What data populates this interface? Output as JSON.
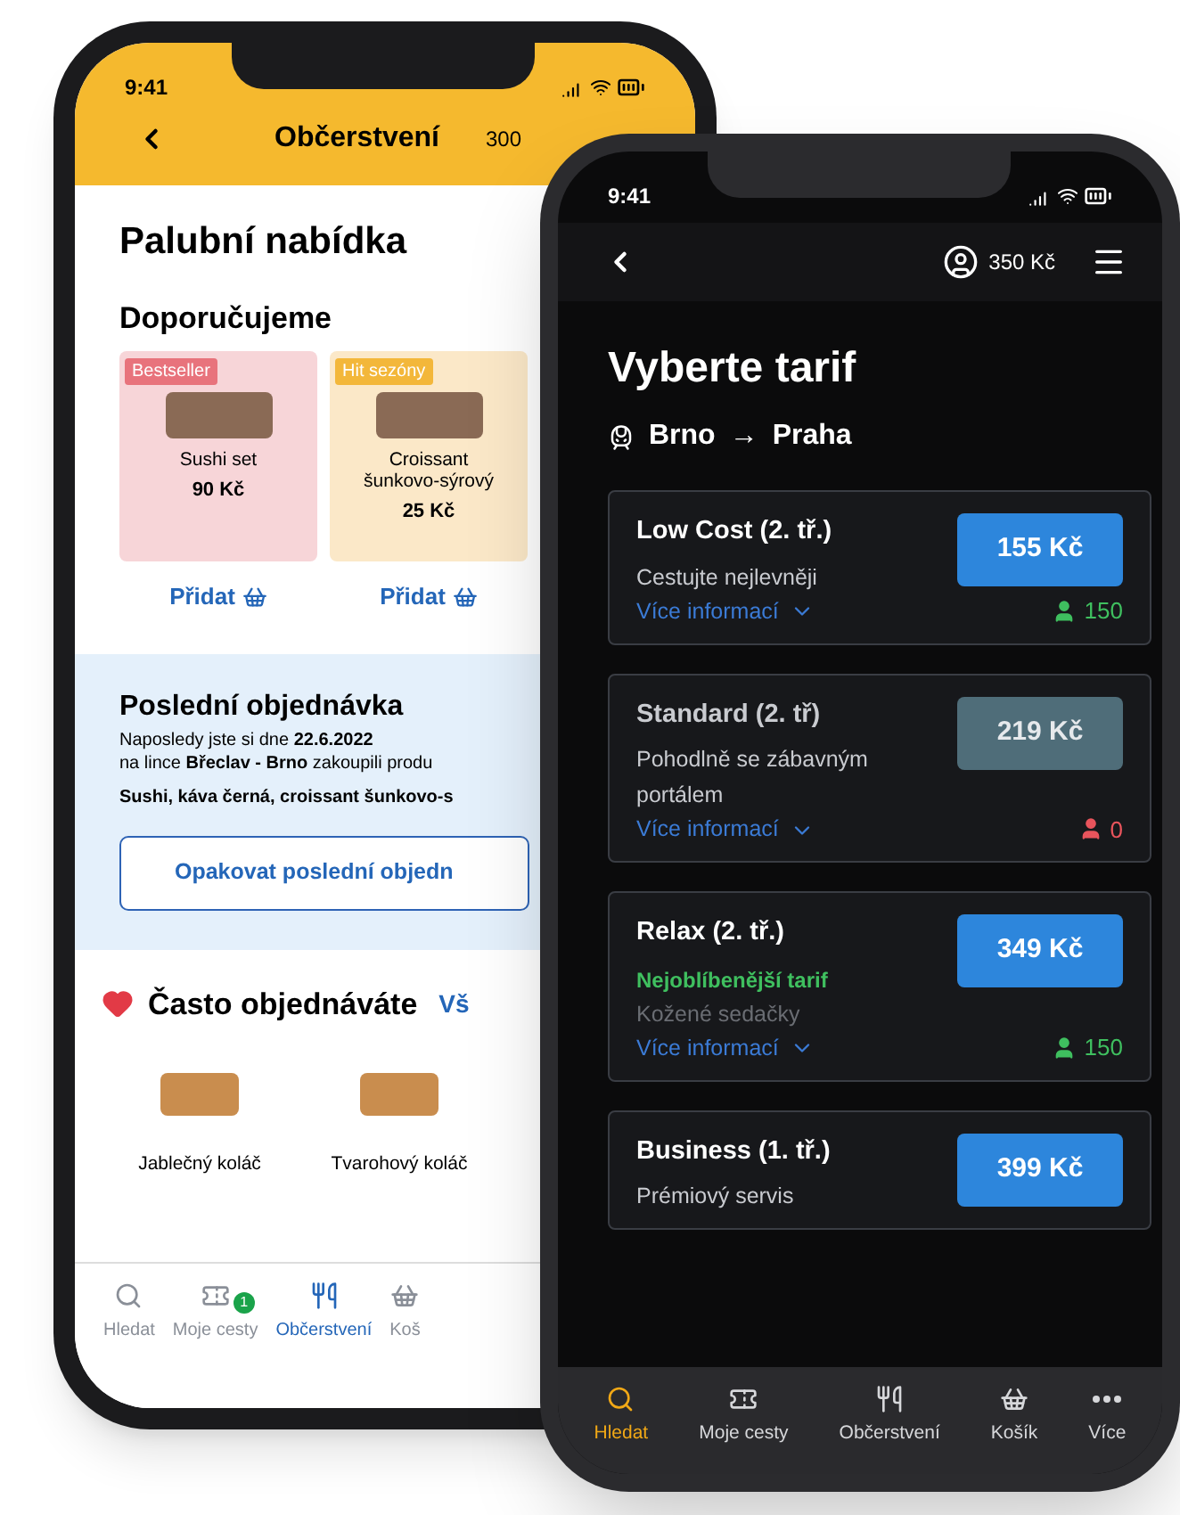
{
  "phone_1": {
    "status_time": "9:41",
    "title": "Občerstvení",
    "balance": "300",
    "heading": "Palubní nabídka",
    "recommended": {
      "title": "Doporučujeme",
      "items": [
        {
          "badge": {
            "text": "Bestseller",
            "color": "#e8737c"
          },
          "color": "#f7d5d8",
          "name": "Sushi set",
          "price": "90 Kč",
          "add": "Přidat"
        },
        {
          "badge": {
            "text": "Hit sezóny",
            "color": "#f3b73a"
          },
          "color": "#fbe8c8",
          "name": "Croissant šunkovo-sýrový",
          "price": "25 Kč",
          "add": "Přidat"
        }
      ]
    },
    "last_order": {
      "title": "Poslední objednávka",
      "lines": [
        "Naposledy jste si dne **22.6.2022**",
        "na lince **Břeclav - Brno** zakoupili produ"
      ],
      "items": "Sushi, káva černá, croissant šunkovo-s",
      "button": "Opakovat poslední objedn"
    },
    "frequent": {
      "title": "Často objednáváte",
      "link": "Vš",
      "items": [
        {
          "name": "Jablečný koláč"
        },
        {
          "name": "Tvarohový koláč"
        }
      ]
    },
    "tab_bar": [
      {
        "label": "Hledat",
        "selected": false
      },
      {
        "label": "Moje cesty",
        "selected": false,
        "badge": "1"
      },
      {
        "label": "Občerstvení",
        "selected": true
      },
      {
        "label": "Koš",
        "selected": false
      }
    ]
  },
  "phone_2": {
    "status_time": "9:41",
    "balance": "350 Kč",
    "title": "Vyberte tarif",
    "route": {
      "from": "Brno",
      "arrow": "→",
      "to": "Praha"
    },
    "tariffs": [
      {
        "name": "Low Cost (2. tř.)",
        "description": "Cestujte nejlevněji",
        "more": "Více informací",
        "price": "155 Kč",
        "disabled": false,
        "seats": "150",
        "color": "#3fbf5f"
      },
      {
        "name": "Standard (2. tř)",
        "description": "Pohodlně se zábavným portálem",
        "more": "Více informací",
        "price": "219 Kč",
        "disabled": true,
        "seats": "0",
        "color": "#e8545c"
      },
      {
        "name": "Relax (2. tř.)",
        "highlight": "Nejoblíbenější tarif",
        "description": "Kožené sedačky",
        "more": "Více informací",
        "price": "349 Kč",
        "disabled": false,
        "seats": "150",
        "color": "#3fbf5f"
      },
      {
        "name": "Business (1. tř.)",
        "description": "Prémiový servis",
        "price": "399 Kč",
        "disabled": false
      }
    ],
    "tab_bar": [
      {
        "label": "Hledat",
        "selected": true
      },
      {
        "label": "Moje cesty",
        "selected": false
      },
      {
        "label": "Občerstvení",
        "selected": false
      },
      {
        "label": "Košík",
        "selected": false
      },
      {
        "label": "Více",
        "selected": false
      }
    ]
  }
}
